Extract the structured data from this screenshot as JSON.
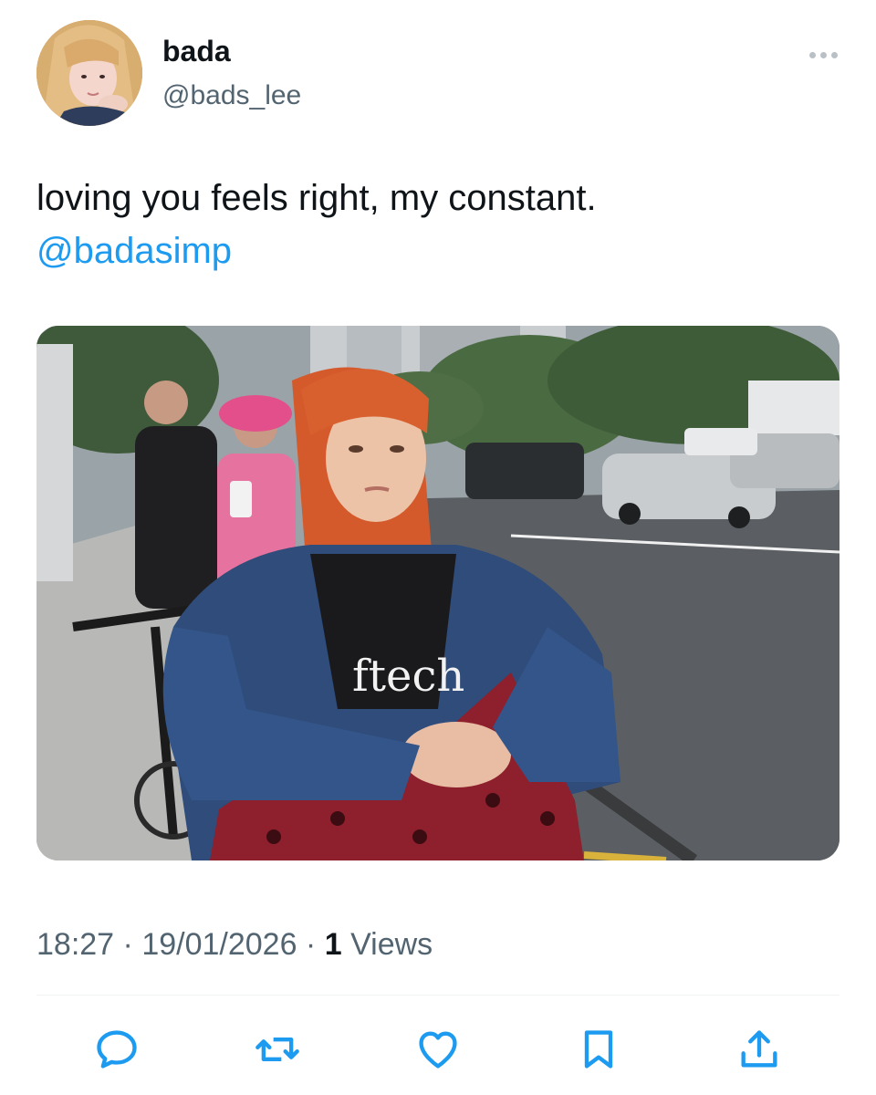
{
  "author": {
    "display_name": "bada",
    "handle": "@bads_lee"
  },
  "tweet": {
    "text": "loving you feels right, my constant.",
    "mention": "@badasimp"
  },
  "photo": {
    "shirt_text": "ftech"
  },
  "meta": {
    "time": "18:27",
    "separator1": " · ",
    "date": "19/01/2026",
    "separator2": " · ",
    "views_count": "1",
    "views_label": " Views"
  },
  "actions": {
    "icons": [
      "reply-icon",
      "retweet-icon",
      "like-icon",
      "bookmark-icon",
      "share-icon"
    ]
  },
  "colors": {
    "accent": "#1d9bf0",
    "secondary_text": "#536471",
    "primary_text": "#0f1419"
  }
}
